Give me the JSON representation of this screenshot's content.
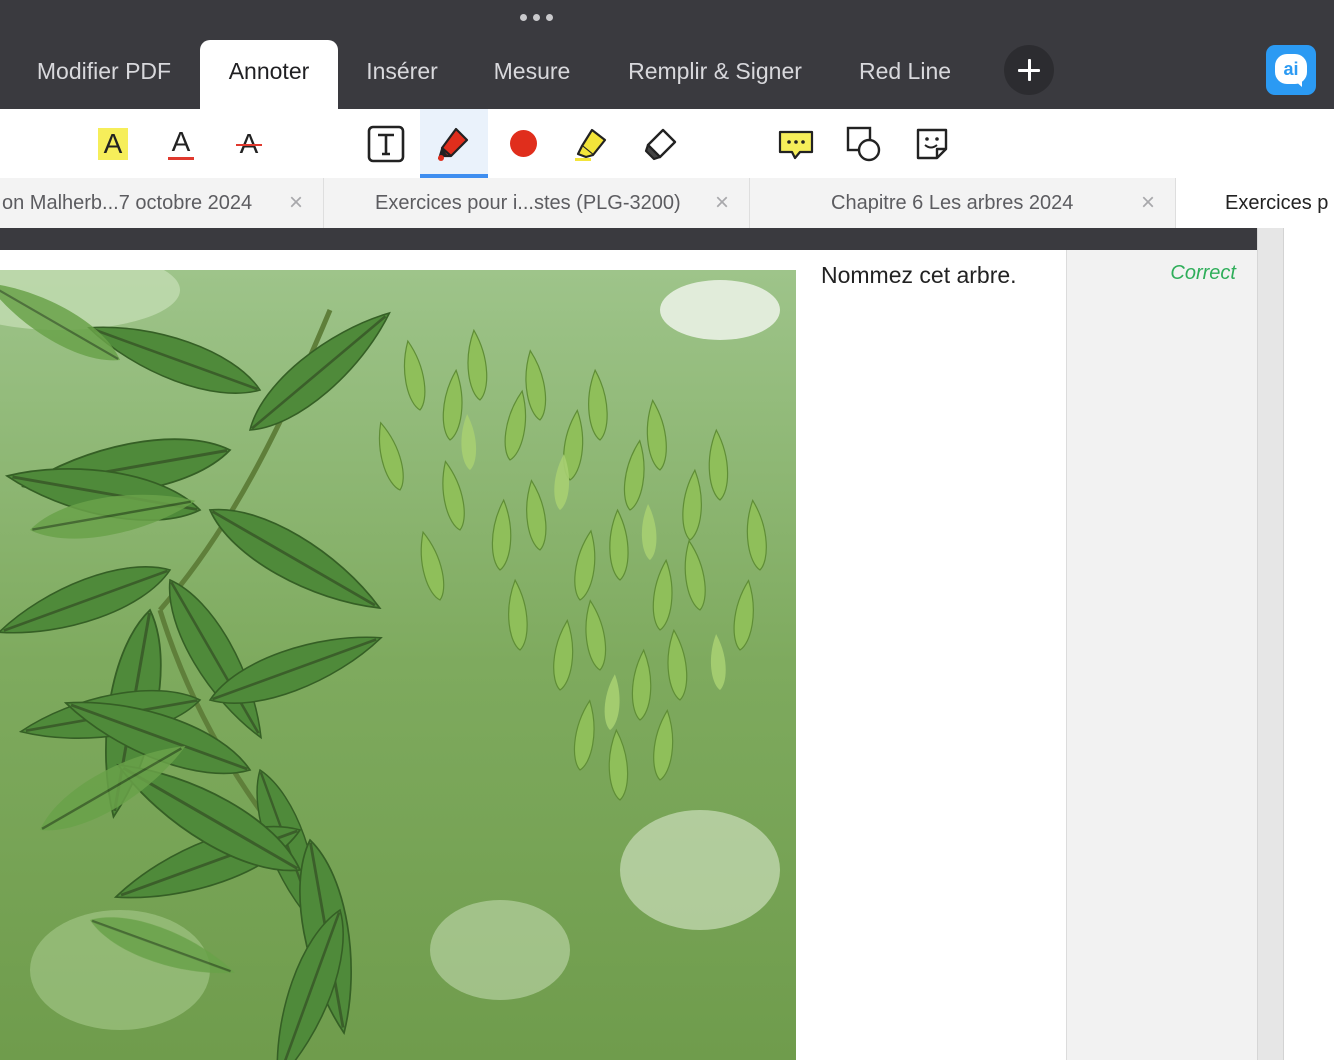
{
  "top_tabs": [
    {
      "label": "Modifier PDF"
    },
    {
      "label": "Annoter"
    },
    {
      "label": "Insérer"
    },
    {
      "label": "Mesure"
    },
    {
      "label": "Remplir & Signer"
    },
    {
      "label": "Red Line"
    }
  ],
  "active_top_tab": "Annoter",
  "ai_button": {
    "label": "ai"
  },
  "tools": [
    {
      "id": "highlight-text",
      "glyph": "A"
    },
    {
      "id": "underline-text",
      "glyph": "A"
    },
    {
      "id": "strikethrough-text",
      "glyph": "A"
    },
    {
      "id": "text-box",
      "icon": "text-box-icon"
    },
    {
      "id": "pen",
      "icon": "pen-icon",
      "selected": true
    },
    {
      "id": "color",
      "icon": "color-dot-icon",
      "color": "#e02e1c"
    },
    {
      "id": "highlighter",
      "icon": "highlighter-icon"
    },
    {
      "id": "eraser",
      "icon": "eraser-icon"
    },
    {
      "id": "comment",
      "icon": "comment-icon"
    },
    {
      "id": "shapes",
      "icon": "shapes-icon"
    },
    {
      "id": "sticker",
      "icon": "sticker-icon"
    }
  ],
  "doc_tabs": [
    {
      "title": "on Malherb...7 octobre 2024",
      "close": "×"
    },
    {
      "title": "Exercices pour i...stes (PLG-3200)",
      "close": "×"
    },
    {
      "title": "Chapitre 6 Les arbres  2024",
      "close": "×"
    },
    {
      "title": "Exercices p"
    }
  ],
  "document": {
    "question": "Nommez cet arbre.",
    "answer": "Correct"
  },
  "colors": {
    "topbar": "#3a3a3f",
    "accent": "#3e8ef0",
    "ai_brand": "#2b9af3",
    "answer_green": "#2fae5a"
  }
}
